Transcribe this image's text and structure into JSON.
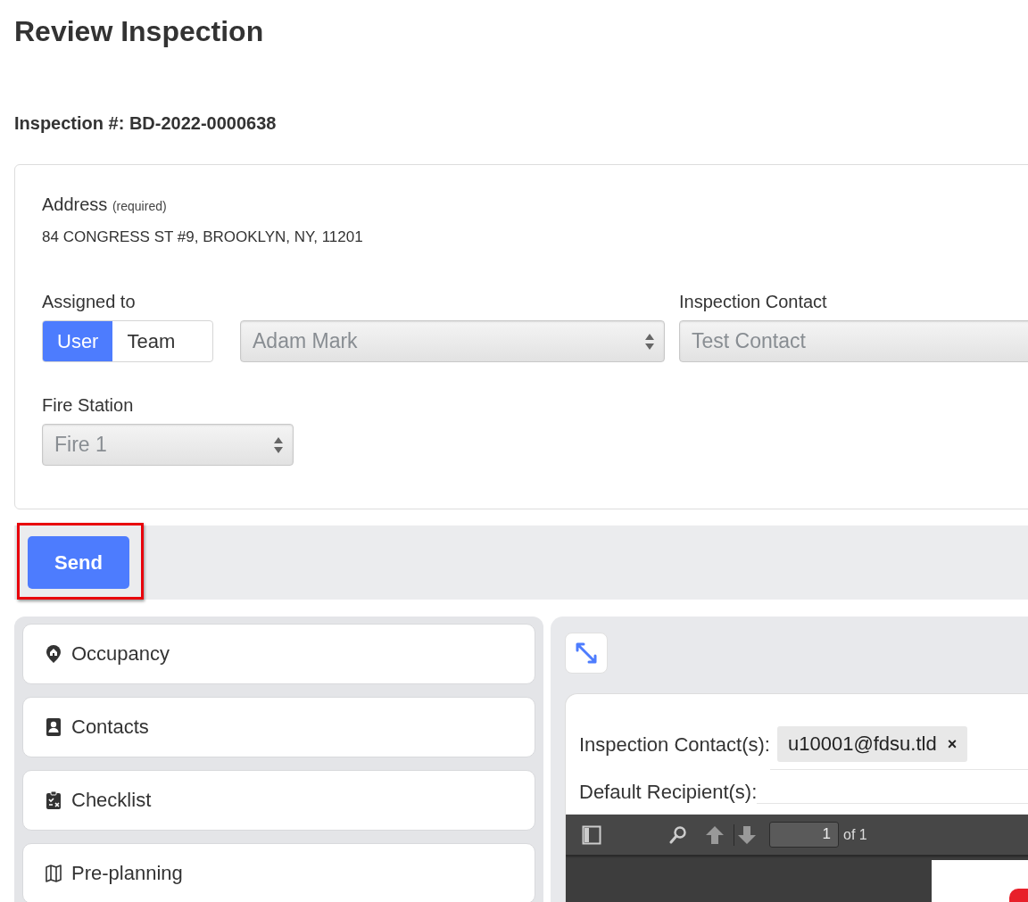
{
  "title": "Review Inspection",
  "inspection_number": "Inspection #: BD-2022-0000638",
  "address": {
    "label": "Address",
    "hint": "(required)",
    "value": "84 CONGRESS ST #9, BROOKLYN, NY, 11201"
  },
  "assigned_to": {
    "label": "Assigned to",
    "options": [
      {
        "label": "User",
        "selected": true
      },
      {
        "label": "Team",
        "selected": false
      }
    ],
    "value": "Adam Mark"
  },
  "inspection_contact": {
    "label": "Inspection Contact",
    "value": "Test Contact"
  },
  "fire_station": {
    "label": "Fire Station",
    "value": "Fire 1"
  },
  "send_button": "Send",
  "sections": [
    {
      "label": "Occupancy",
      "kind": "pin"
    },
    {
      "label": "Contacts",
      "kind": "contact"
    },
    {
      "label": "Checklist",
      "kind": "checklist"
    },
    {
      "label": "Pre-planning",
      "kind": "map"
    }
  ],
  "preview": {
    "contacts_label": "Inspection Contact(s):",
    "chips": [
      {
        "text": "u10001@fdsu.tld",
        "remove": "×"
      }
    ],
    "recipients_label": "Default Recipient(s):",
    "pdf_toolbar": {
      "page": "1",
      "page_count": "of 1"
    }
  }
}
